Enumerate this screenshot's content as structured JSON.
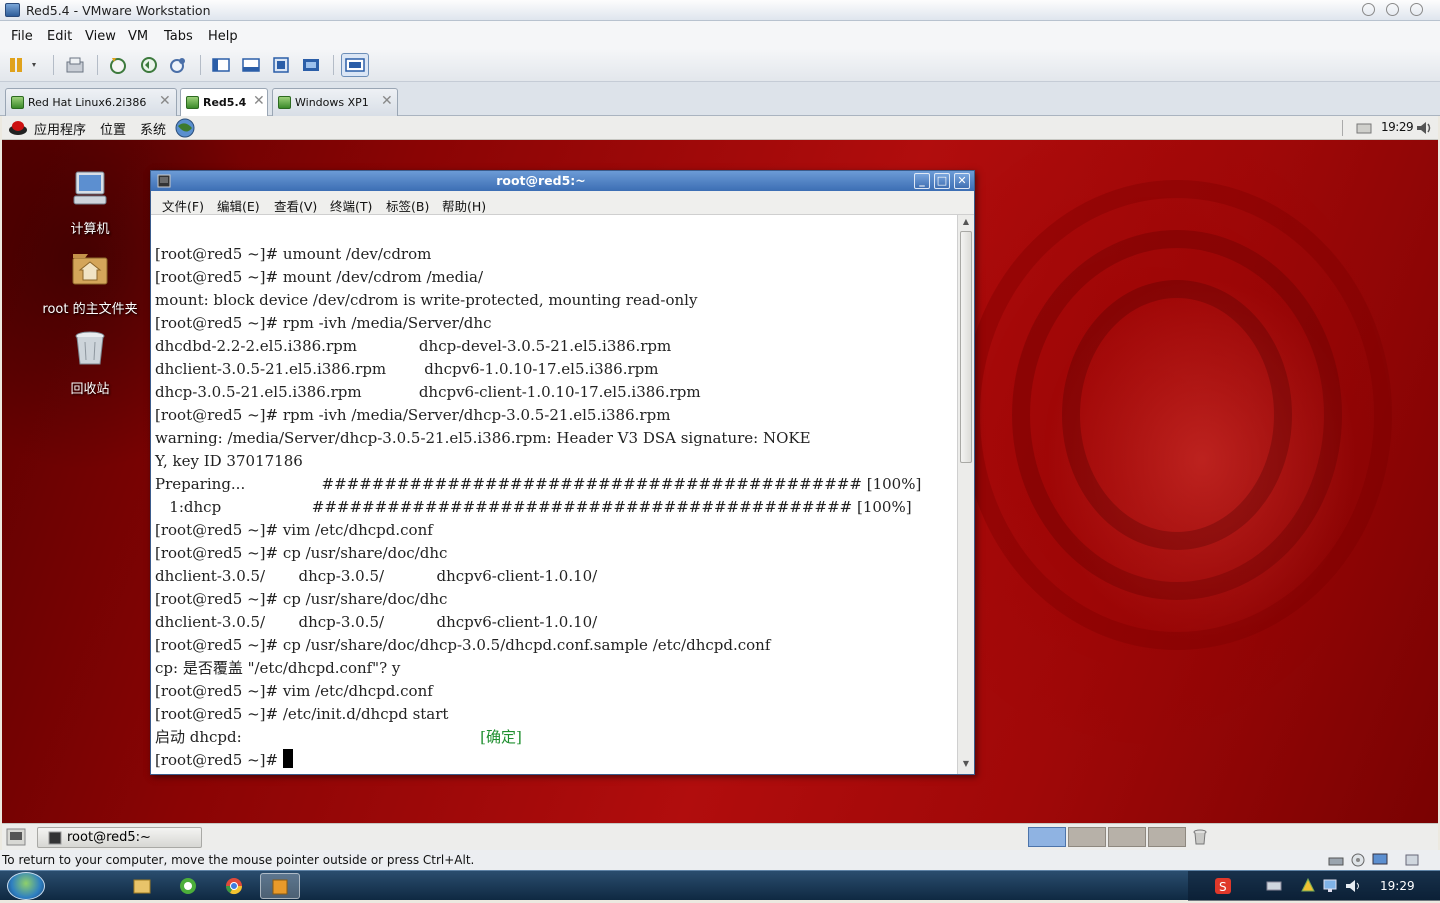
{
  "vmware": {
    "title": "Red5.4 - VMware Workstation",
    "menu": [
      "File",
      "Edit",
      "View",
      "VM",
      "Tabs",
      "Help"
    ],
    "tabs": [
      {
        "label": "Red Hat Linux6.2i386",
        "active": false
      },
      {
        "label": "Red5.4",
        "active": true
      },
      {
        "label": "Windows XP1",
        "active": false
      }
    ],
    "status_message": "To return to your computer, move the mouse pointer outside or press Ctrl+Alt."
  },
  "guest_panel": {
    "menus": [
      "应用程序",
      "位置",
      "系统"
    ],
    "clock": "19:29"
  },
  "desktop_icons": [
    {
      "label": "计算机",
      "icon": "computer-icon"
    },
    {
      "label": "root 的主文件夹",
      "icon": "home-folder-icon"
    },
    {
      "label": "回收站",
      "icon": "trash-icon"
    }
  ],
  "terminal": {
    "title": "root@red5:~",
    "menu": [
      "文件(F)",
      "编辑(E)",
      "查看(V)",
      "终端(T)",
      "标签(B)",
      "帮助(H)"
    ],
    "lines": [
      "[root@red5 ~]# umount /dev/cdrom",
      "[root@red5 ~]# mount /dev/cdrom /media/",
      "mount: block device /dev/cdrom is write-protected, mounting read-only",
      "[root@red5 ~]# rpm -ivh /media/Server/dhc",
      "dhcdbd-2.2-2.el5.i386.rpm             dhcp-devel-3.0.5-21.el5.i386.rpm",
      "dhclient-3.0.5-21.el5.i386.rpm        dhcpv6-1.0.10-17.el5.i386.rpm",
      "dhcp-3.0.5-21.el5.i386.rpm            dhcpv6-client-1.0.10-17.el5.i386.rpm",
      "[root@red5 ~]# rpm -ivh /media/Server/dhcp-3.0.5-21.el5.i386.rpm",
      "warning: /media/Server/dhcp-3.0.5-21.el5.i386.rpm: Header V3 DSA signature: NOKE",
      "Y, key ID 37017186",
      "Preparing...                ########################################### [100%]",
      "   1:dhcp                   ########################################### [100%]",
      "[root@red5 ~]# vim /etc/dhcpd.conf",
      "[root@red5 ~]# cp /usr/share/doc/dhc",
      "dhclient-3.0.5/       dhcp-3.0.5/           dhcpv6-client-1.0.10/",
      "[root@red5 ~]# cp /usr/share/doc/dhc",
      "dhclient-3.0.5/       dhcp-3.0.5/           dhcpv6-client-1.0.10/",
      "[root@red5 ~]# cp /usr/share/doc/dhcp-3.0.5/dhcpd.conf.sample /etc/dhcpd.conf",
      "cp: 是否覆盖 \"/etc/dhcpd.conf\"? y",
      "[root@red5 ~]# vim /etc/dhcpd.conf",
      "[root@red5 ~]# /etc/init.d/dhcpd start"
    ],
    "start_line_prefix": "启动 dhcpd:",
    "start_line_padding": "                                                  ",
    "start_status": "[确定]",
    "prompt": "[root@red5 ~]# "
  },
  "guest_bottom": {
    "task_label": "root@red5:~",
    "workspaces": 4,
    "active_workspace": 1
  },
  "host": {
    "clock": "19:29"
  }
}
